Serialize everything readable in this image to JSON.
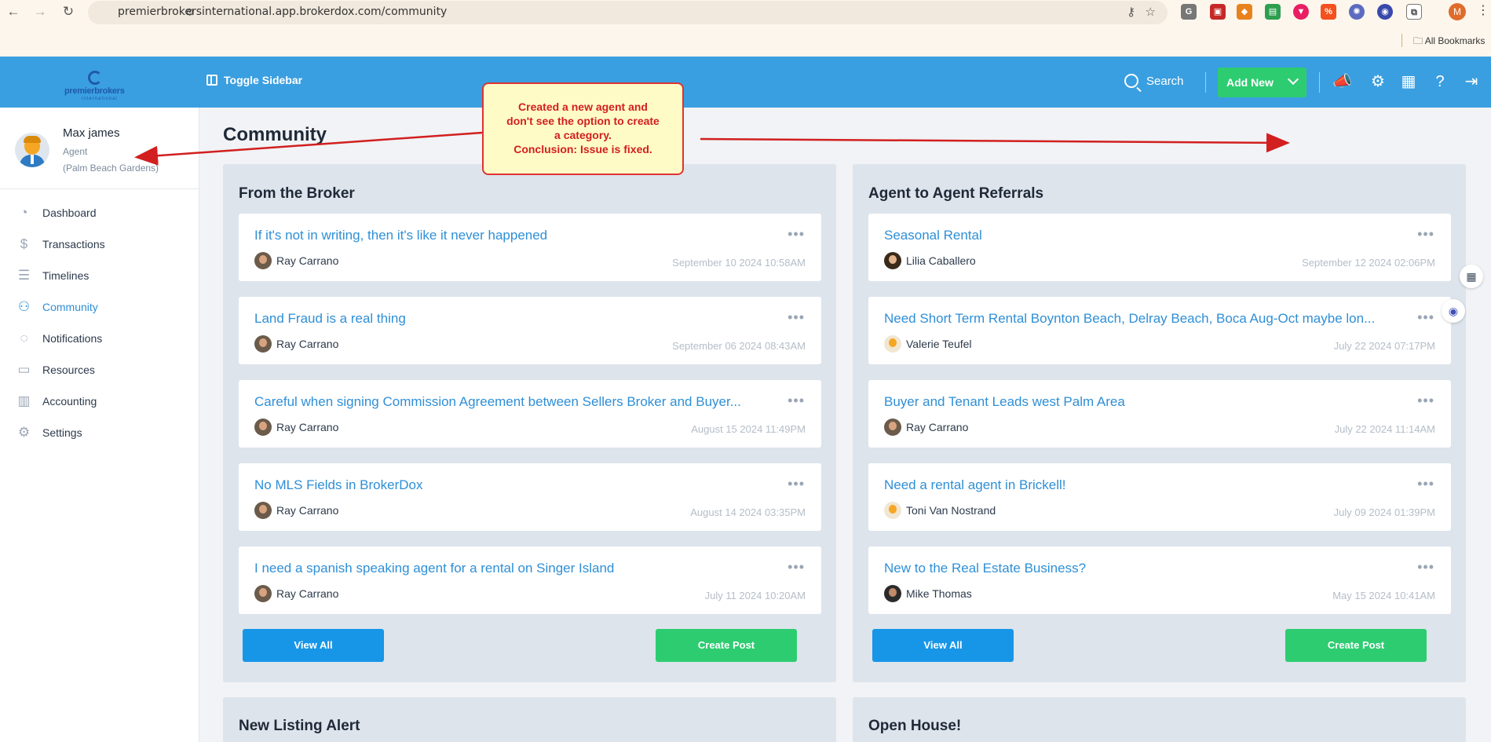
{
  "browser": {
    "url": "premierbrokersinternational.app.brokerdox.com/community",
    "bookmarks_label": "All Bookmarks",
    "profile_initial": "M"
  },
  "header": {
    "logo_text": "premierbrokers",
    "logo_sub": "international",
    "toggle_sidebar": "Toggle Sidebar",
    "search": "Search",
    "add_new": "Add New"
  },
  "user": {
    "name": "Max james",
    "role": "Agent",
    "office": "(Palm Beach Gardens)"
  },
  "nav": {
    "items": [
      {
        "label": "Dashboard",
        "icon": "dashboard-icon"
      },
      {
        "label": "Transactions",
        "icon": "dollar-icon"
      },
      {
        "label": "Timelines",
        "icon": "timeline-icon"
      },
      {
        "label": "Community",
        "icon": "community-icon"
      },
      {
        "label": "Notifications",
        "icon": "chat-icon"
      },
      {
        "label": "Resources",
        "icon": "folder-icon"
      },
      {
        "label": "Accounting",
        "icon": "accounting-icon"
      },
      {
        "label": "Settings",
        "icon": "gear-icon"
      }
    ],
    "active": "Community"
  },
  "page": {
    "title": "Community"
  },
  "panels": {
    "broker": {
      "title": "From the Broker",
      "posts": [
        {
          "title": "If it's not in writing, then it's like it never happened",
          "author": "Ray Carrano",
          "date": "September 10 2024 10:58AM"
        },
        {
          "title": "Land Fraud is a real thing",
          "author": "Ray Carrano",
          "date": "September 06 2024 08:43AM"
        },
        {
          "title": "Careful when signing Commission Agreement between Sellers Broker and Buyer...",
          "author": "Ray Carrano",
          "date": "August 15 2024 11:49PM"
        },
        {
          "title": "No MLS Fields in BrokerDox",
          "author": "Ray Carrano",
          "date": "August 14 2024 03:35PM"
        },
        {
          "title": "I need a spanish speaking agent for a rental on Singer Island",
          "author": "Ray Carrano",
          "date": "July 11 2024 10:20AM"
        }
      ],
      "view_all": "View All",
      "create_post": "Create Post"
    },
    "referrals": {
      "title": "Agent to Agent Referrals",
      "posts": [
        {
          "title": "Seasonal Rental",
          "author": "Lilia Caballero",
          "date": "September 12 2024 02:06PM"
        },
        {
          "title": "Need Short Term Rental Boynton Beach, Delray Beach, Boca Aug-Oct maybe lon...",
          "author": "Valerie Teufel",
          "date": "July 22 2024 07:17PM"
        },
        {
          "title": "Buyer and Tenant Leads west Palm Area",
          "author": "Ray Carrano",
          "date": "July 22 2024 11:14AM"
        },
        {
          "title": "Need a rental agent in Brickell!",
          "author": "Toni Van Nostrand",
          "date": "July 09 2024 01:39PM"
        },
        {
          "title": "New to the Real Estate Business?",
          "author": "Mike Thomas",
          "date": "May 15 2024 10:41AM"
        }
      ],
      "view_all": "View All",
      "create_post": "Create Post"
    },
    "listing": {
      "title": "New Listing Alert"
    },
    "openhouse": {
      "title": "Open House!"
    }
  },
  "annotation": {
    "line1": "Created a new agent and",
    "line2": "don't see the option to create",
    "line3": "a category.",
    "line4": "Conclusion: Issue is fixed.",
    "color": "#d21f1f"
  },
  "colors": {
    "header": "#3a9fe0",
    "accent": "#2e8fd6",
    "green": "#2ecc71",
    "blue_button": "#1796e8"
  }
}
